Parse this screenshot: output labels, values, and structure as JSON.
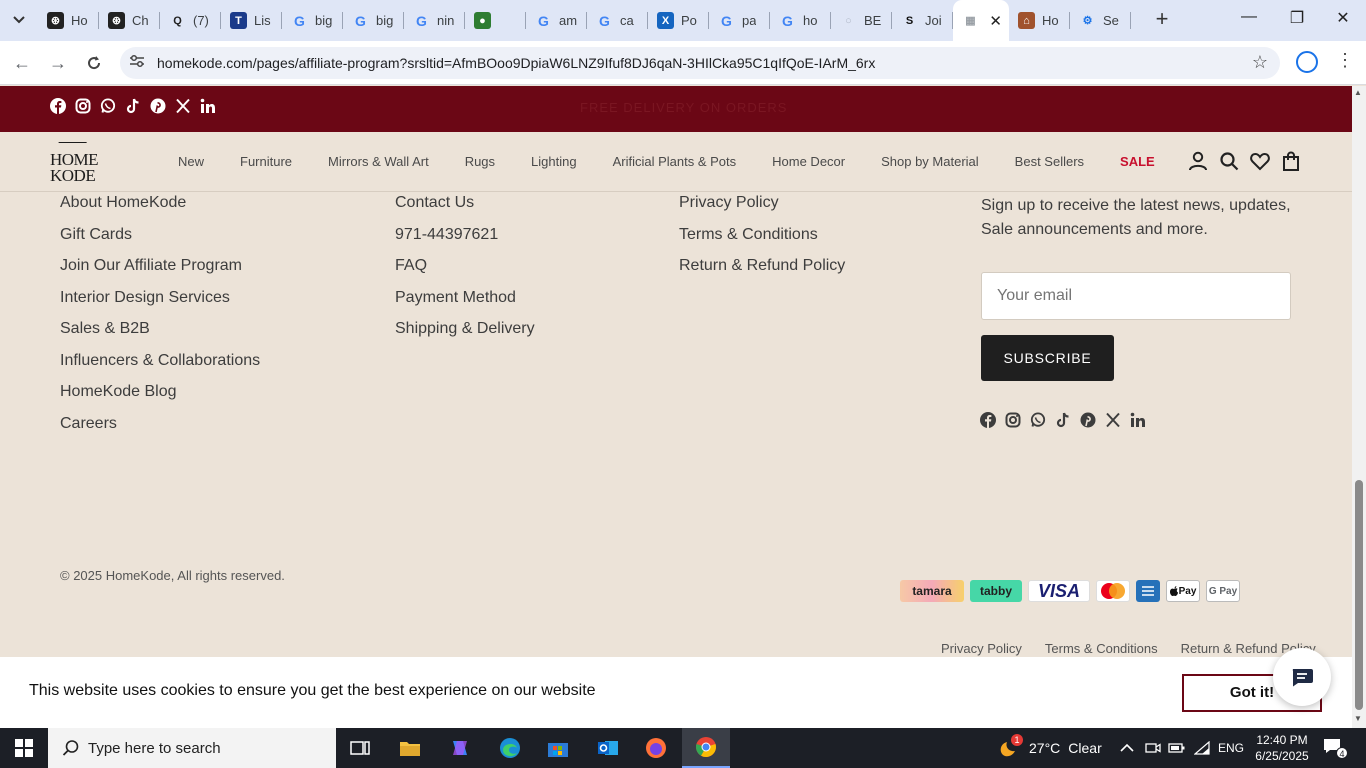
{
  "browser": {
    "tabs": [
      {
        "label": "Ho",
        "icon": "openai-icon",
        "color": "#222222"
      },
      {
        "label": "Ch",
        "icon": "openai-icon",
        "color": "#222222"
      },
      {
        "label": "(7)",
        "icon": "quora-icon",
        "color": "#222222"
      },
      {
        "label": "Lis",
        "icon": "ttp-icon",
        "color": "#1a3a8a"
      },
      {
        "label": "big",
        "icon": "google-icon",
        "color": "#4285f4"
      },
      {
        "label": "big",
        "icon": "google-icon",
        "color": "#4285f4"
      },
      {
        "label": "nin",
        "icon": "google-icon",
        "color": "#4285f4"
      },
      {
        "label": "",
        "icon": "game-icon",
        "color": "#2e7d32"
      },
      {
        "label": "am",
        "icon": "google-icon",
        "color": "#4285f4"
      },
      {
        "label": "ca",
        "icon": "google-icon",
        "color": "#4285f4"
      },
      {
        "label": "Po",
        "icon": "xf-icon",
        "color": "#1565c0"
      },
      {
        "label": "pa",
        "icon": "google-icon",
        "color": "#4285f4"
      },
      {
        "label": "ho",
        "icon": "google-icon",
        "color": "#4285f4"
      },
      {
        "label": "BE",
        "icon": "circle-icon",
        "color": "#b0b8c8"
      },
      {
        "label": "Joi",
        "icon": "s-icon",
        "color": "#111111"
      },
      {
        "label": "",
        "icon": "page-icon",
        "color": "#9aa0a6",
        "active": true
      },
      {
        "label": "Ho",
        "icon": "homekode-icon",
        "color": "#a0522d"
      },
      {
        "label": "Se",
        "icon": "settings-icon",
        "color": "#1a73e8"
      }
    ],
    "url": "homekode.com/pages/affiliate-program?srsltid=AfmBOoo9DpiaW6LNZ9Ifuf8DJ6qaN-3HIlCka95C1qIfQoE-IArM_6rx"
  },
  "site": {
    "announcement": "FREE DELIVERY ON ORDERS",
    "logo": {
      "line1": "HOME",
      "line2": "KODE"
    },
    "nav": [
      "New",
      "Furniture",
      "Mirrors & Wall Art",
      "Rugs",
      "Lighting",
      "Arificial Plants & Pots",
      "Home Decor",
      "Shop by Material",
      "Best Sellers",
      "SALE"
    ],
    "footer": {
      "col1": [
        "About HomeKode",
        "Gift Cards",
        "Join Our Affiliate Program",
        "Interior Design Services",
        "Sales & B2B",
        "Influencers & Collaborations",
        "HomeKode Blog",
        "Careers"
      ],
      "col2": [
        "Contact Us",
        "971-44397621",
        "FAQ",
        "Payment Method",
        "Shipping & Delivery"
      ],
      "col3": [
        "Privacy Policy",
        "Terms & Conditions",
        "Return & Refund Policy"
      ],
      "newsletter_text": "Sign up to receive the latest news, updates, Sale announcements and more.",
      "email_placeholder": "Your email",
      "subscribe_label": "SUBSCRIBE",
      "copyright": "© 2025 HomeKode, All rights reserved.",
      "payments": {
        "tamara": "tamara",
        "tabby": "tabby",
        "visa": "VISA",
        "amex": "AMERICAN EXPRESS",
        "apple": "Pay",
        "gpay": "G Pay"
      },
      "bottom_links": [
        "Privacy Policy",
        "Terms & Conditions",
        "Return & Refund Policy"
      ]
    },
    "cookie": {
      "text": "This website uses cookies to ensure you get the best experience on our website",
      "button": "Got it!"
    }
  },
  "taskbar": {
    "search_placeholder": "Type here to search",
    "weather": {
      "temp": "27°C",
      "condition": "Clear",
      "badge": "1"
    },
    "lang": "ENG",
    "time": "12:40 PM",
    "date": "6/25/2025",
    "notifications": "4"
  },
  "colors": {
    "brand": "#6b0715",
    "sale": "#c8102e",
    "background": "#ece3d8"
  }
}
